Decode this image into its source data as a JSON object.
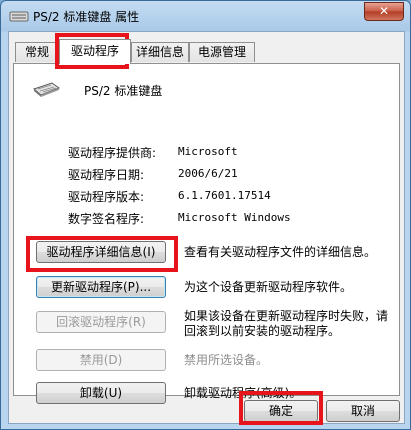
{
  "window": {
    "title": "PS/2 标准键盘 属性",
    "close_label": "✕"
  },
  "tabs": [
    {
      "label": "常规"
    },
    {
      "label": "驱动程序"
    },
    {
      "label": "详细信息"
    },
    {
      "label": "电源管理"
    }
  ],
  "device": {
    "name": "PS/2 标准键盘"
  },
  "info": [
    {
      "label": "驱动程序提供商:",
      "value": "Microsoft"
    },
    {
      "label": "驱动程序日期:",
      "value": "2006/6/21"
    },
    {
      "label": "驱动程序版本:",
      "value": "6.1.7601.17514"
    },
    {
      "label": "数字签名程序:",
      "value": "Microsoft Windows"
    }
  ],
  "actions": [
    {
      "button": "驱动程序详细信息(I)",
      "desc": "查看有关驱动程序文件的详细信息。"
    },
    {
      "button": "更新驱动程序(P)...",
      "desc": "为这个设备更新驱动程序软件。"
    },
    {
      "button": "回滚驱动程序(R)",
      "desc_line1": "如果该设备在更新驱动程序时失败，请",
      "desc_line2": "回滚到以前安装的驱动程序。"
    },
    {
      "button": "禁用(D)",
      "desc": "禁用所选设备。"
    },
    {
      "button": "卸载(U)",
      "desc": "卸载驱动程序(高级)。"
    }
  ],
  "footer": {
    "ok_label": "确定",
    "cancel_label": "取消"
  },
  "colors": {
    "highlight": "#e8141b"
  }
}
